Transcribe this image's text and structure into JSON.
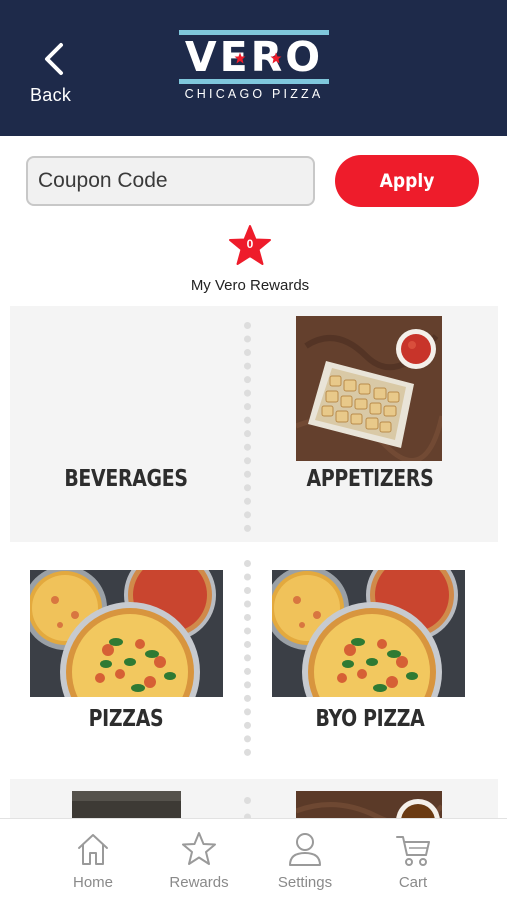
{
  "header": {
    "back_label": "Back",
    "logo_text": "VERO",
    "logo_subtitle": "CHICAGO PIZZA"
  },
  "coupon": {
    "placeholder": "Coupon Code",
    "value": "",
    "apply_label": "Apply"
  },
  "rewards": {
    "count": "0",
    "label": "My Vero Rewards"
  },
  "categories": [
    {
      "label": "BEVERAGES"
    },
    {
      "label": "APPETIZERS"
    },
    {
      "label": "PIZZAS"
    },
    {
      "label": "BYO PIZZA"
    }
  ],
  "tabbar": {
    "items": [
      {
        "label": "Home",
        "icon": "home-icon"
      },
      {
        "label": "Rewards",
        "icon": "star-icon"
      },
      {
        "label": "Settings",
        "icon": "person-icon"
      },
      {
        "label": "Cart",
        "icon": "cart-icon"
      }
    ]
  },
  "colors": {
    "header_bg": "#1e2a4a",
    "accent_red": "#ee1c2b",
    "logo_bar": "#7fc7dc"
  }
}
